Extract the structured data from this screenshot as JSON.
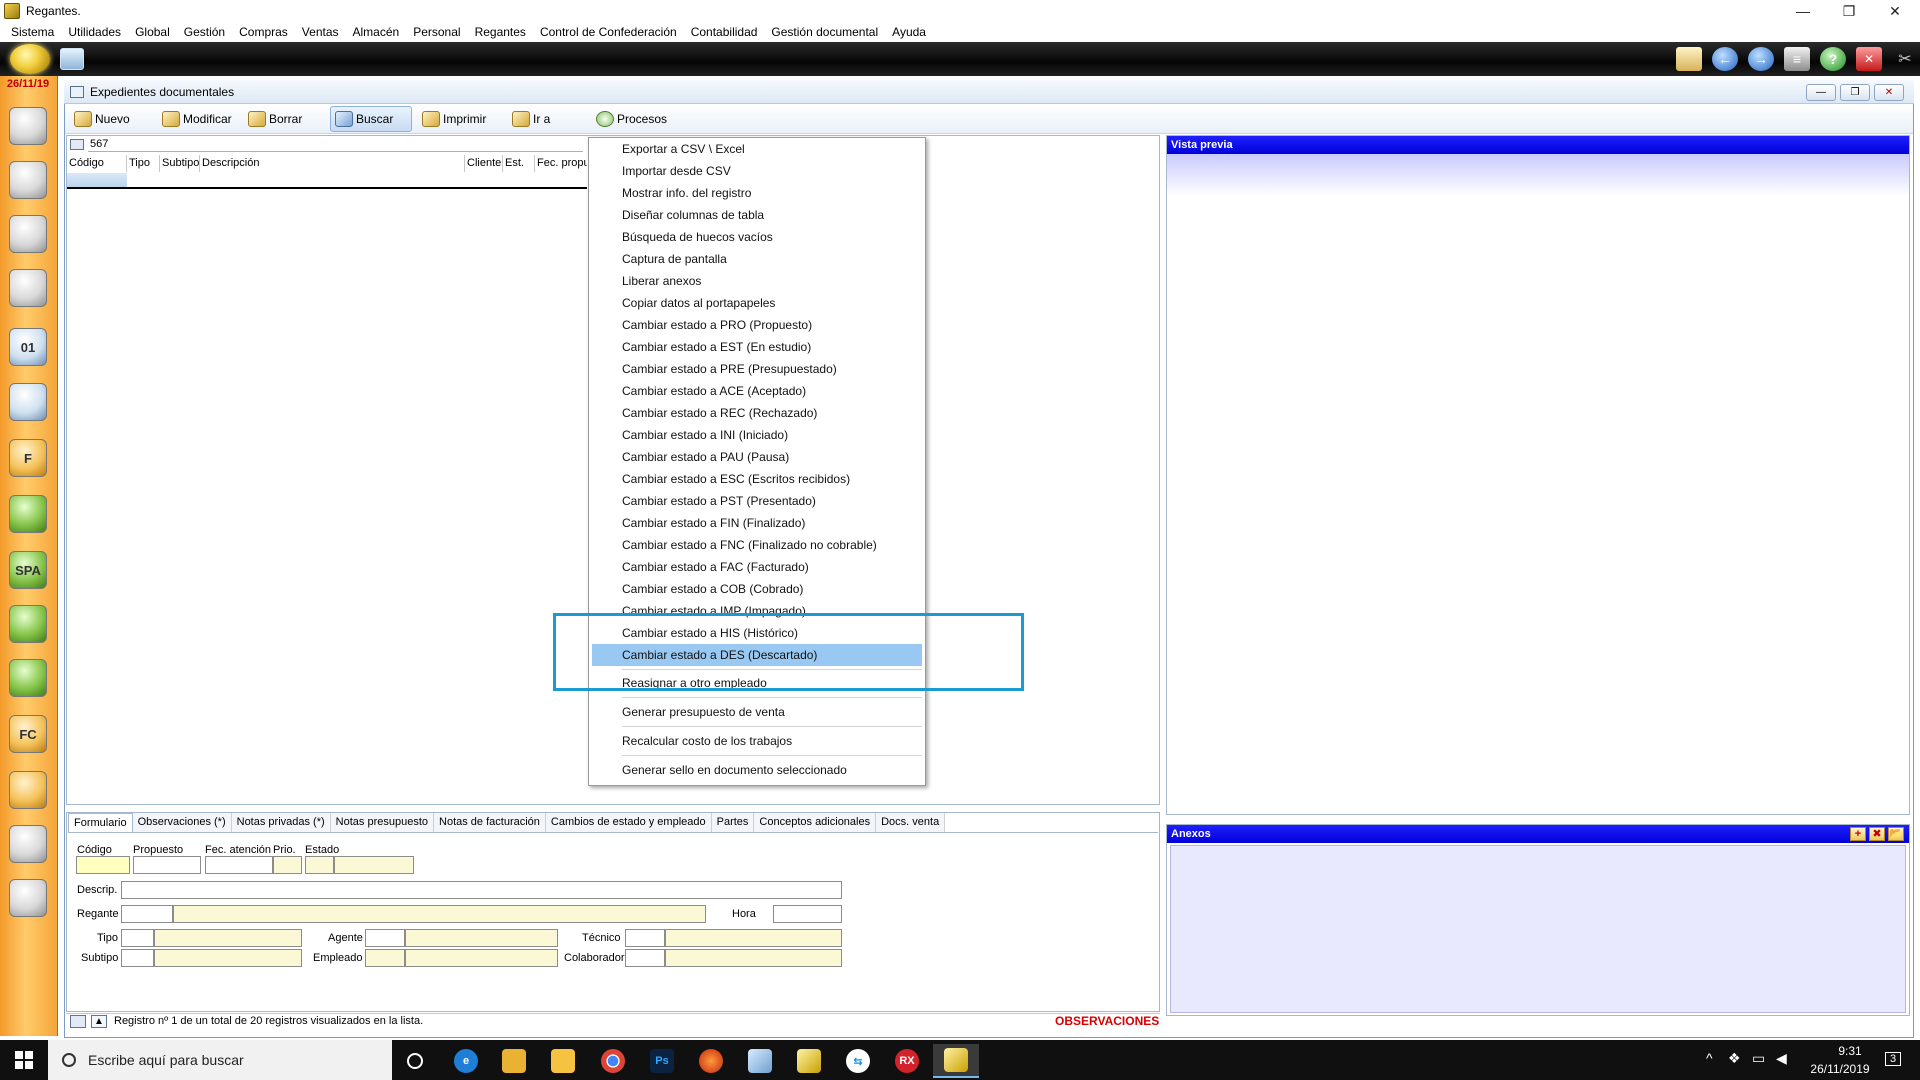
{
  "window": {
    "title": "Regantes.",
    "minimize": "—",
    "restore": "❐",
    "close": "✕"
  },
  "menu": [
    "Sistema",
    "Utilidades",
    "Global",
    "Gestión",
    "Compras",
    "Ventas",
    "Almacén",
    "Personal",
    "Regantes",
    "Control de Confederación",
    "Contabilidad",
    "Gestión documental",
    "Ayuda"
  ],
  "sidebar": {
    "date": "26/11/19",
    "icons": [
      "users-icon",
      "user-a-icon",
      "user-icon",
      "user-icon",
      "database-01-icon",
      "database-edit-icon",
      "folder-f-icon",
      "tools-icon",
      "spa-icon",
      "bag-green-icon",
      "bag-green-icon",
      "fc-doc-icon",
      "bag-orange-icon",
      "list-document-icon",
      "list-document-icon"
    ],
    "spa_label": "SPA",
    "fc_label": "FC",
    "db_label": "01",
    "f_label": "F"
  },
  "child": {
    "title": "Expedientes documentales"
  },
  "toolbar": {
    "nuevo": "Nuevo",
    "modificar": "Modificar",
    "borrar": "Borrar",
    "buscar": "Buscar",
    "imprimir": "Imprimir",
    "ir_a": "Ir a",
    "procesos": "Procesos"
  },
  "search": {
    "value": "567"
  },
  "list": {
    "columns": [
      "Código",
      "Tipo",
      "Subtipo",
      "Descripción",
      "Cliente",
      "Est.",
      "Fec. propu"
    ]
  },
  "preview": {
    "title": "Vista previa"
  },
  "anexos": {
    "title": "Anexos",
    "add": "+",
    "remove": "✖",
    "open": "📂"
  },
  "form": {
    "tabs": [
      "Formulario",
      "Observaciones (*)",
      "Notas privadas (*)",
      "Notas presupuesto",
      "Notas de facturación",
      "Cambios de estado y empleado",
      "Partes",
      "Conceptos adicionales",
      "Docs. venta"
    ],
    "labels": {
      "codigo": "Código",
      "propuesto": "Propuesto",
      "fec_atencion": "Fec. atención",
      "prio": "Prio.",
      "estado": "Estado",
      "descrip": "Descrip.",
      "regante": "Regante",
      "hora": "Hora",
      "tipo": "Tipo",
      "subtipo": "Subtipo",
      "agente": "Agente",
      "empleado": "Empleado",
      "tecnico": "Técnico",
      "colaborador": "Colaborador"
    }
  },
  "status": {
    "text": "Registro nº 1 de un total de 20 registros visualizados en la lista.",
    "observaciones": "OBSERVACIONES",
    "up": "▲"
  },
  "context_menu": {
    "items": [
      "Exportar a CSV \\ Excel",
      "Importar desde CSV",
      "Mostrar info. del registro",
      "Diseñar columnas de tabla",
      "Búsqueda de huecos vacíos",
      "Captura de pantalla",
      "Liberar anexos",
      "Copiar datos al portapapeles",
      "Cambiar estado a PRO (Propuesto)",
      "Cambiar estado a EST (En estudio)",
      "Cambiar estado a PRE (Presupuestado)",
      "Cambiar estado a ACE (Aceptado)",
      "Cambiar estado a REC (Rechazado)",
      "Cambiar estado a INI (Iniciado)",
      "Cambiar estado a PAU (Pausa)",
      "Cambiar estado a ESC (Escritos recibidos)",
      "Cambiar estado a PST (Presentado)",
      "Cambiar estado a FIN (Finalizado)",
      "Cambiar estado a FNC (Finalizado no cobrable)",
      "Cambiar estado a FAC (Facturado)",
      "Cambiar estado a COB (Cobrado)",
      "Cambiar estado a IMP (Impagado)",
      "Cambiar estado a HIS (Histórico)",
      "Cambiar estado a DES (Descartado)",
      "Reasignar a otro empleado",
      "Generar presupuesto de venta",
      "Recalcular costo de los trabajos",
      "Generar sello en documento seleccionado"
    ],
    "selected_index": 23
  },
  "taskbar": {
    "search_placeholder": "Escribe aquí para buscar",
    "time": "9:31",
    "date": "26/11/2019",
    "notifications": "3",
    "ps_label": "Ps",
    "rx_label": "RX"
  },
  "colors": {
    "accent_blue": "#0000d8",
    "highlight_box": "#1a9ad1",
    "menu_selection": "#99c9f2",
    "sidebar_orange": "#f39a2a",
    "observaciones_red": "#d80000"
  }
}
